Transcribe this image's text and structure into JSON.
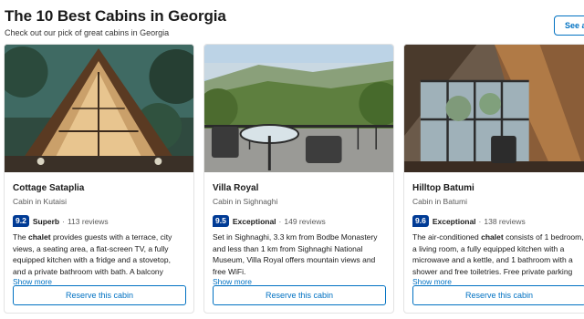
{
  "header": {
    "title": "The 10 Best Cabins in Georgia",
    "subtitle": "Check out our pick of great cabins in Georgia",
    "see_all": "See all"
  },
  "cards": [
    {
      "name": "Cottage Sataplia",
      "type": "Cabin in Kutaisi",
      "score": "9.2",
      "rating_word": "Superb",
      "dot": "·",
      "reviews": "113 reviews",
      "desc_pre": "The ",
      "desc_bold": "chalet",
      "desc_post": " provides guests with a terrace, city views, a seating area, a flat-screen TV, a fully equipped kitchen with a fridge and a stovetop, and a private bathroom with bath. A balcony with...",
      "more": "Show more",
      "reserve": "Reserve this cabin",
      "image_icon": "a-frame-cabin-image"
    },
    {
      "name": "Villa Royal",
      "type": "Cabin in Sighnaghi",
      "score": "9.5",
      "rating_word": "Exceptional",
      "dot": "·",
      "reviews": "149 reviews",
      "desc_pre": "Set in Sighnaghi, 3.3 km from Bodbe Monastery and less than 1 km from Sighnaghi National Museum, Villa Royal offers mountain views and free WiFi.",
      "desc_bold": "",
      "desc_post": "",
      "more": "Show more",
      "reserve": "Reserve this cabin",
      "image_icon": "balcony-view-image"
    },
    {
      "name": "Hilltop Batumi",
      "type": "Cabin in Batumi",
      "score": "9.6",
      "rating_word": "Exceptional",
      "dot": "·",
      "reviews": "138 reviews",
      "desc_pre": "The air-conditioned ",
      "desc_bold": "chalet",
      "desc_post": " consists of 1 bedroom, a living room, a fully equipped kitchen with a microwave and a kettle, and 1 bathroom with a shower and free toiletries. Free private parking is...",
      "more": "Show more",
      "reserve": "Reserve this cabin",
      "image_icon": "chalet-interior-image"
    }
  ],
  "colors": {
    "brand_blue": "#0071c2",
    "score_bg": "#003b95"
  }
}
